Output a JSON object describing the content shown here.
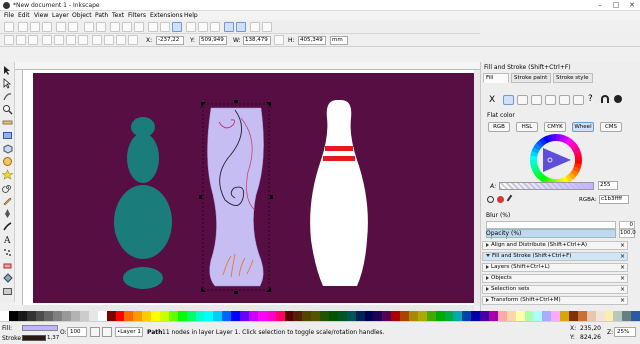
{
  "window": {
    "title": "*New document 1 - Inkscape",
    "controls": {
      "minimize": "–",
      "maximize": "□",
      "close": "✕"
    }
  },
  "menu": [
    "File",
    "Edit",
    "View",
    "Layer",
    "Object",
    "Path",
    "Text",
    "Filters",
    "Extensions",
    "Help"
  ],
  "controls_bar": {
    "x_label": "X:",
    "x_value": "-237,22",
    "y_label": "Y:",
    "y_value": "509,949",
    "w_label": "W:",
    "w_value": "138,479",
    "h_label": "H:",
    "h_value": "405,349",
    "unit": "mm"
  },
  "colors": {
    "artboard": "#570e43",
    "teal": "#1a7d7b",
    "vase": "#c6bef2",
    "pin_stripe": "#e41a1e",
    "accent": "#3b8be0"
  },
  "panel": {
    "title": "Fill and Stroke (Shift+Ctrl+F)",
    "tabs": [
      "Fill",
      "Stroke paint",
      "Stroke style"
    ],
    "fill_type_x": "X",
    "fill_type_question": "?",
    "flat_color_label": "Flat color",
    "modes": [
      "RGB",
      "HSL",
      "CMYK",
      "Wheel",
      "CMS"
    ],
    "alpha_label": "A:",
    "alpha_value": "255",
    "rgba_label": "RGBA:",
    "rgba_value": "c1b3ffff",
    "blur_label": "Blur (%)",
    "blur_value": "0",
    "opacity_label": "Opacity (%)",
    "opacity_value": "100,0"
  },
  "dock_items": [
    "Align and Distribute (Shift+Ctrl+A)",
    "Fill and Stroke (Shift+Ctrl+F)",
    "Layers (Shift+Ctrl+L)",
    "Objects",
    "Selection sets",
    "Transform (Shift+Ctrl+M)"
  ],
  "status": {
    "fill_label": "Fill:",
    "stroke_label": "Stroke:",
    "stroke_width": "1,37",
    "o_label": "O:",
    "o_value": "100",
    "layer": "•Layer 1",
    "message_bold": "Path",
    "message": " 11 nodes in layer Layer 1. Click selection to toggle scale/rotation handles.",
    "x_label": "X:",
    "x_value": "235,20",
    "y_label": "Y:",
    "y_value": "824,26",
    "z_label": "Z:",
    "zoom": "25%"
  },
  "palette_colors": [
    "#ffffff",
    "#000000",
    "#1a1a1a",
    "#333333",
    "#4d4d4d",
    "#666666",
    "#808080",
    "#999999",
    "#b3b3b3",
    "#cccccc",
    "#e6e6e6",
    "#ffffff",
    "#800000",
    "#ff0000",
    "#ff6600",
    "#ff9900",
    "#ffcc00",
    "#ffff00",
    "#ccff00",
    "#66ff00",
    "#00ff00",
    "#00ff66",
    "#00ffcc",
    "#00ffff",
    "#00ccff",
    "#0066ff",
    "#0000ff",
    "#6600ff",
    "#cc00ff",
    "#ff00ff",
    "#ff00cc",
    "#ff0066",
    "#550000",
    "#552200",
    "#554400",
    "#555500",
    "#225500",
    "#005500",
    "#005522",
    "#005555",
    "#002255",
    "#000055",
    "#220055",
    "#550055",
    "#aa0000",
    "#aa4400",
    "#aa8800",
    "#aaaa00",
    "#44aa00",
    "#00aa00",
    "#00aa44",
    "#00aaaa",
    "#0044aa",
    "#0000aa",
    "#4400aa",
    "#aa00aa",
    "#ffaaaa",
    "#ffd5aa",
    "#ffffaa",
    "#aaffaa",
    "#aaffff",
    "#aaaaff",
    "#ffaaff",
    "#d4aa00",
    "#803300",
    "#c87137",
    "#e9c6af",
    "#f4e3d7",
    "#ffeeaa",
    "#b7c8be",
    "#668080",
    "#2c5aa0"
  ]
}
